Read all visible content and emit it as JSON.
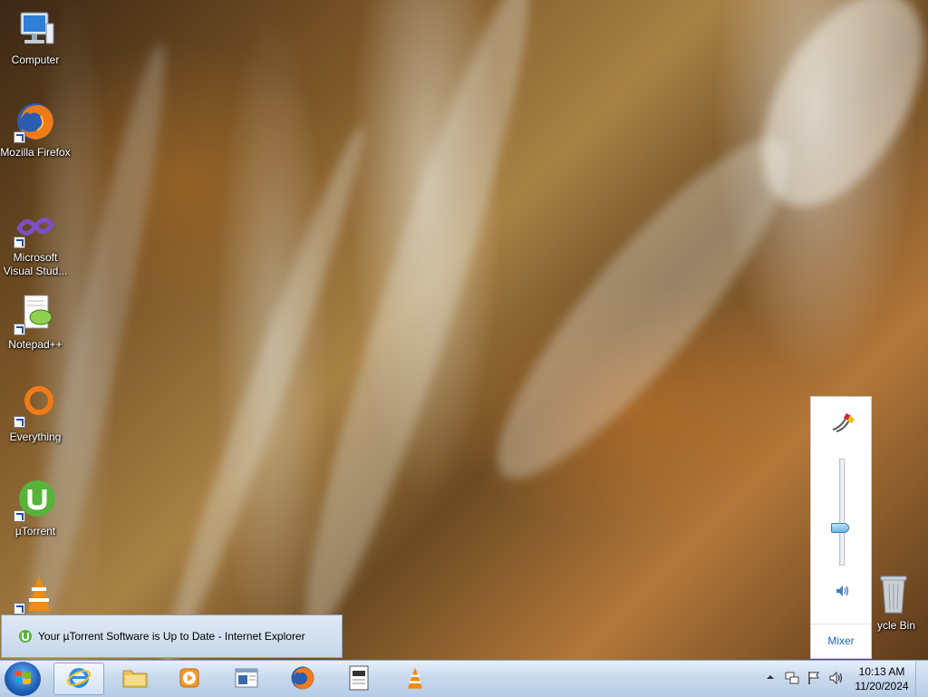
{
  "desktop_icons": [
    {
      "label": "Computer",
      "icon": "computer-icon",
      "shortcut": false
    },
    {
      "label": "Mozilla Firefox",
      "icon": "firefox-icon",
      "shortcut": true
    },
    {
      "label": "Microsoft Visual Stud...",
      "icon": "visual-studio-icon",
      "shortcut": true
    },
    {
      "label": "Notepad++",
      "icon": "notepadpp-icon",
      "shortcut": true
    },
    {
      "label": "Everything",
      "icon": "everything-icon",
      "shortcut": true
    },
    {
      "label": "µTorrent",
      "icon": "utorrent-icon",
      "shortcut": true
    },
    {
      "label": "",
      "icon": "vlc-icon",
      "shortcut": true
    },
    {
      "label": "Recycle Bin",
      "visible_label": "ycle Bin",
      "icon": "recycle-bin-icon",
      "shortcut": false
    }
  ],
  "taskbar_preview": {
    "title": "Your µTorrent Software is Up to Date - Internet Explorer"
  },
  "volume_flyout": {
    "level": 0.35,
    "mixer_label": "Mixer"
  },
  "tray": {
    "time": "10:13 AM",
    "date": "11/20/2024"
  },
  "colors": {
    "accent": "#3b7dd8",
    "taskbar": "#c9daee"
  }
}
